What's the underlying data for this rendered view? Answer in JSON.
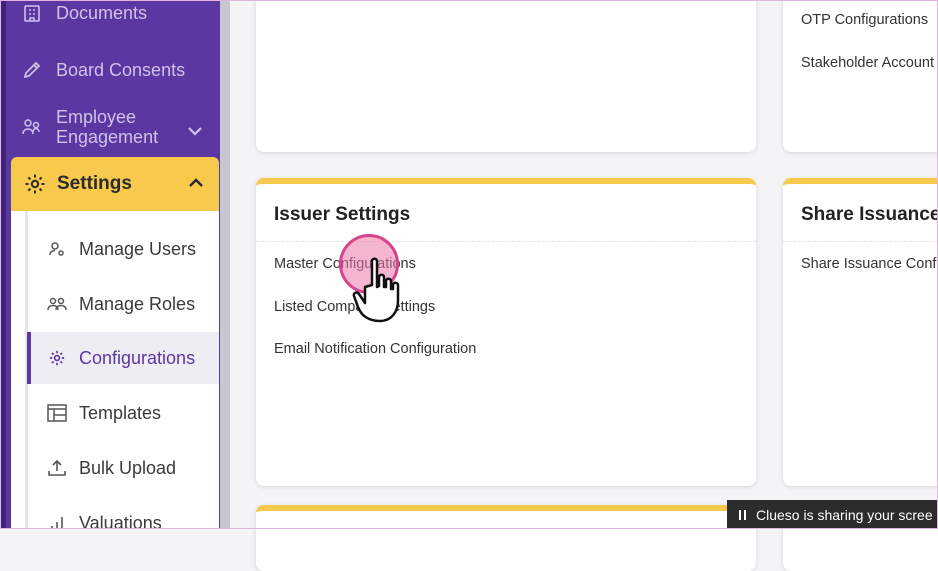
{
  "sidebar": {
    "items": [
      {
        "label": "Documents",
        "icon": "building-icon"
      },
      {
        "label": "Board Consents",
        "icon": "pencil-icon"
      },
      {
        "label": "Employee Engagement",
        "icon": "people-network-icon"
      }
    ],
    "settings": {
      "label": "Settings",
      "icon": "gear-icon"
    },
    "submenu": [
      {
        "label": "Manage Users",
        "icon": "user-cog-icon"
      },
      {
        "label": "Manage Roles",
        "icon": "group-icon"
      },
      {
        "label": "Configurations",
        "icon": "gear-icon",
        "active": true
      },
      {
        "label": "Templates",
        "icon": "template-icon"
      },
      {
        "label": "Bulk Upload",
        "icon": "upload-icon"
      },
      {
        "label": "Valuations",
        "icon": "chart-icon"
      }
    ]
  },
  "cards": {
    "top_right_links": [
      "OTP Configurations",
      "Stakeholder Account"
    ],
    "issuer": {
      "title": "Issuer Settings",
      "links": [
        "Master Configurations",
        "Listed Company Settings",
        "Email Notification Configuration"
      ]
    },
    "share": {
      "title": "Share Issuance S",
      "links": [
        "Share Issuance Config"
      ]
    }
  },
  "banner": {
    "text": "Clueso is sharing your scree"
  },
  "colors": {
    "sidebar": "#5b37a1",
    "accent": "#f7c94c",
    "cursor": "#d6458c"
  }
}
